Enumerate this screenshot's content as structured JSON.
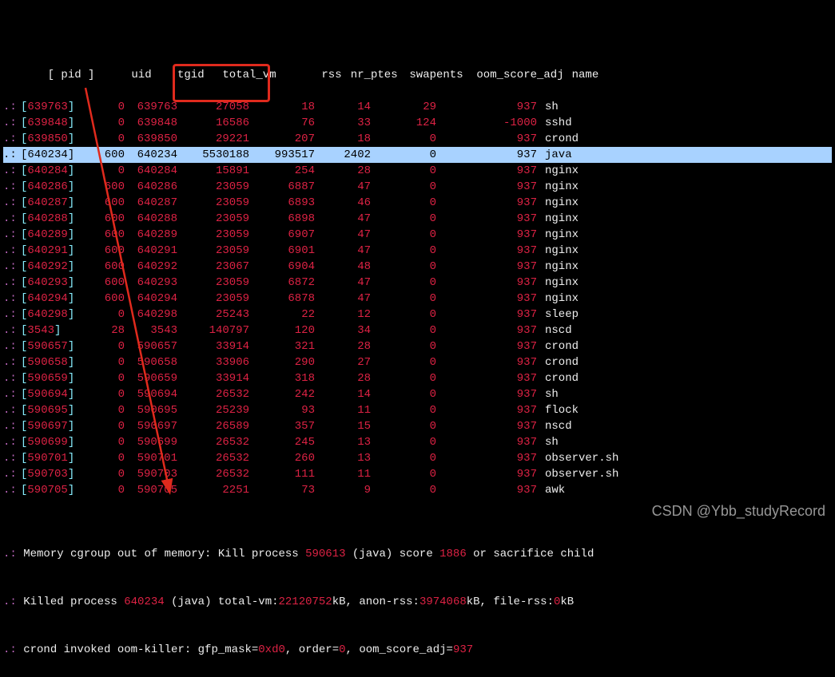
{
  "header": {
    "pid": "[ pid ]",
    "uid": "uid",
    "tgid": "tgid",
    "total_vm": "total_vm",
    "rss": "rss",
    "nr_ptes": "nr_ptes",
    "swapents": "swapents",
    "oom_score_adj": "oom_score_adj",
    "name": "name"
  },
  "rows": [
    {
      "pid": "639763",
      "uid": "0",
      "tgid": "639763",
      "total_vm": "27058",
      "rss": "18",
      "nr_ptes": "14",
      "swapents": "29",
      "oom_score_adj": "937",
      "name": "sh",
      "hl": false
    },
    {
      "pid": "639848",
      "uid": "0",
      "tgid": "639848",
      "total_vm": "16586",
      "rss": "76",
      "nr_ptes": "33",
      "swapents": "124",
      "oom_score_adj": "-1000",
      "name": "sshd",
      "hl": false
    },
    {
      "pid": "639850",
      "uid": "0",
      "tgid": "639850",
      "total_vm": "29221",
      "rss": "207",
      "nr_ptes": "18",
      "swapents": "0",
      "oom_score_adj": "937",
      "name": "crond",
      "hl": false
    },
    {
      "pid": "640234",
      "uid": "600",
      "tgid": "640234",
      "total_vm": "5530188",
      "rss": "993517",
      "nr_ptes": "2402",
      "swapents": "0",
      "oom_score_adj": "937",
      "name": "java",
      "hl": true
    },
    {
      "pid": "640284",
      "uid": "0",
      "tgid": "640284",
      "total_vm": "15891",
      "rss": "254",
      "nr_ptes": "28",
      "swapents": "0",
      "oom_score_adj": "937",
      "name": "nginx",
      "hl": false
    },
    {
      "pid": "640286",
      "uid": "600",
      "tgid": "640286",
      "total_vm": "23059",
      "rss": "6887",
      "nr_ptes": "47",
      "swapents": "0",
      "oom_score_adj": "937",
      "name": "nginx",
      "hl": false
    },
    {
      "pid": "640287",
      "uid": "600",
      "tgid": "640287",
      "total_vm": "23059",
      "rss": "6893",
      "nr_ptes": "46",
      "swapents": "0",
      "oom_score_adj": "937",
      "name": "nginx",
      "hl": false
    },
    {
      "pid": "640288",
      "uid": "600",
      "tgid": "640288",
      "total_vm": "23059",
      "rss": "6898",
      "nr_ptes": "47",
      "swapents": "0",
      "oom_score_adj": "937",
      "name": "nginx",
      "hl": false
    },
    {
      "pid": "640289",
      "uid": "600",
      "tgid": "640289",
      "total_vm": "23059",
      "rss": "6907",
      "nr_ptes": "47",
      "swapents": "0",
      "oom_score_adj": "937",
      "name": "nginx",
      "hl": false
    },
    {
      "pid": "640291",
      "uid": "600",
      "tgid": "640291",
      "total_vm": "23059",
      "rss": "6901",
      "nr_ptes": "47",
      "swapents": "0",
      "oom_score_adj": "937",
      "name": "nginx",
      "hl": false
    },
    {
      "pid": "640292",
      "uid": "600",
      "tgid": "640292",
      "total_vm": "23067",
      "rss": "6904",
      "nr_ptes": "48",
      "swapents": "0",
      "oom_score_adj": "937",
      "name": "nginx",
      "hl": false
    },
    {
      "pid": "640293",
      "uid": "600",
      "tgid": "640293",
      "total_vm": "23059",
      "rss": "6872",
      "nr_ptes": "47",
      "swapents": "0",
      "oom_score_adj": "937",
      "name": "nginx",
      "hl": false
    },
    {
      "pid": "640294",
      "uid": "600",
      "tgid": "640294",
      "total_vm": "23059",
      "rss": "6878",
      "nr_ptes": "47",
      "swapents": "0",
      "oom_score_adj": "937",
      "name": "nginx",
      "hl": false
    },
    {
      "pid": "640298",
      "uid": "0",
      "tgid": "640298",
      "total_vm": "25243",
      "rss": "22",
      "nr_ptes": "12",
      "swapents": "0",
      "oom_score_adj": "937",
      "name": "sleep",
      "hl": false
    },
    {
      "pid": "3543",
      "uid": "28",
      "tgid": "3543",
      "total_vm": "140797",
      "rss": "120",
      "nr_ptes": "34",
      "swapents": "0",
      "oom_score_adj": "937",
      "name": "nscd",
      "hl": false,
      "short": true
    },
    {
      "pid": "590657",
      "uid": "0",
      "tgid": "590657",
      "total_vm": "33914",
      "rss": "321",
      "nr_ptes": "28",
      "swapents": "0",
      "oom_score_adj": "937",
      "name": "crond",
      "hl": false
    },
    {
      "pid": "590658",
      "uid": "0",
      "tgid": "590658",
      "total_vm": "33906",
      "rss": "290",
      "nr_ptes": "27",
      "swapents": "0",
      "oom_score_adj": "937",
      "name": "crond",
      "hl": false
    },
    {
      "pid": "590659",
      "uid": "0",
      "tgid": "590659",
      "total_vm": "33914",
      "rss": "318",
      "nr_ptes": "28",
      "swapents": "0",
      "oom_score_adj": "937",
      "name": "crond",
      "hl": false
    },
    {
      "pid": "590694",
      "uid": "0",
      "tgid": "590694",
      "total_vm": "26532",
      "rss": "242",
      "nr_ptes": "14",
      "swapents": "0",
      "oom_score_adj": "937",
      "name": "sh",
      "hl": false
    },
    {
      "pid": "590695",
      "uid": "0",
      "tgid": "590695",
      "total_vm": "25239",
      "rss": "93",
      "nr_ptes": "11",
      "swapents": "0",
      "oom_score_adj": "937",
      "name": "flock",
      "hl": false
    },
    {
      "pid": "590697",
      "uid": "0",
      "tgid": "590697",
      "total_vm": "26589",
      "rss": "357",
      "nr_ptes": "15",
      "swapents": "0",
      "oom_score_adj": "937",
      "name": "nscd",
      "hl": false
    },
    {
      "pid": "590699",
      "uid": "0",
      "tgid": "590699",
      "total_vm": "26532",
      "rss": "245",
      "nr_ptes": "13",
      "swapents": "0",
      "oom_score_adj": "937",
      "name": "sh",
      "hl": false
    },
    {
      "pid": "590701",
      "uid": "0",
      "tgid": "590701",
      "total_vm": "26532",
      "rss": "260",
      "nr_ptes": "13",
      "swapents": "0",
      "oom_score_adj": "937",
      "name": "observer.sh",
      "hl": false
    },
    {
      "pid": "590703",
      "uid": "0",
      "tgid": "590703",
      "total_vm": "26532",
      "rss": "111",
      "nr_ptes": "11",
      "swapents": "0",
      "oom_score_adj": "937",
      "name": "observer.sh",
      "hl": false
    },
    {
      "pid": "590705",
      "uid": "0",
      "tgid": "590705",
      "total_vm": "2251",
      "rss": "73",
      "nr_ptes": "9",
      "swapents": "0",
      "oom_score_adj": "937",
      "name": "awk",
      "hl": false
    }
  ],
  "footer": {
    "line1_a": "Memory cgroup out of memory: Kill process ",
    "line1_pid": "590613",
    "line1_b": " (java) score ",
    "line1_score": "1886",
    "line1_c": " or sacrifice child",
    "line2_a": "Killed process ",
    "line2_pid": "640234",
    "line2_b": " (java) total-vm:",
    "line2_vm": "22120752",
    "line2_c": "kB, anon-rss:",
    "line2_rss": "3974068",
    "line2_d": "kB, file-rss:",
    "line2_frss": "0",
    "line2_e": "kB",
    "line3_a": "crond invoked oom-killer: gfp_mask=",
    "line3_mask": "0xd0",
    "line3_b": ", order=",
    "line3_order": "0",
    "line3_c": ", oom_score_adj=",
    "line3_adj": "937"
  },
  "watermark": "CSDN @Ybb_studyRecord",
  "annotation": {
    "box_target": "total_vm of 640234",
    "arrow_meaning": "points from highlighted java process down to Killed process line"
  }
}
